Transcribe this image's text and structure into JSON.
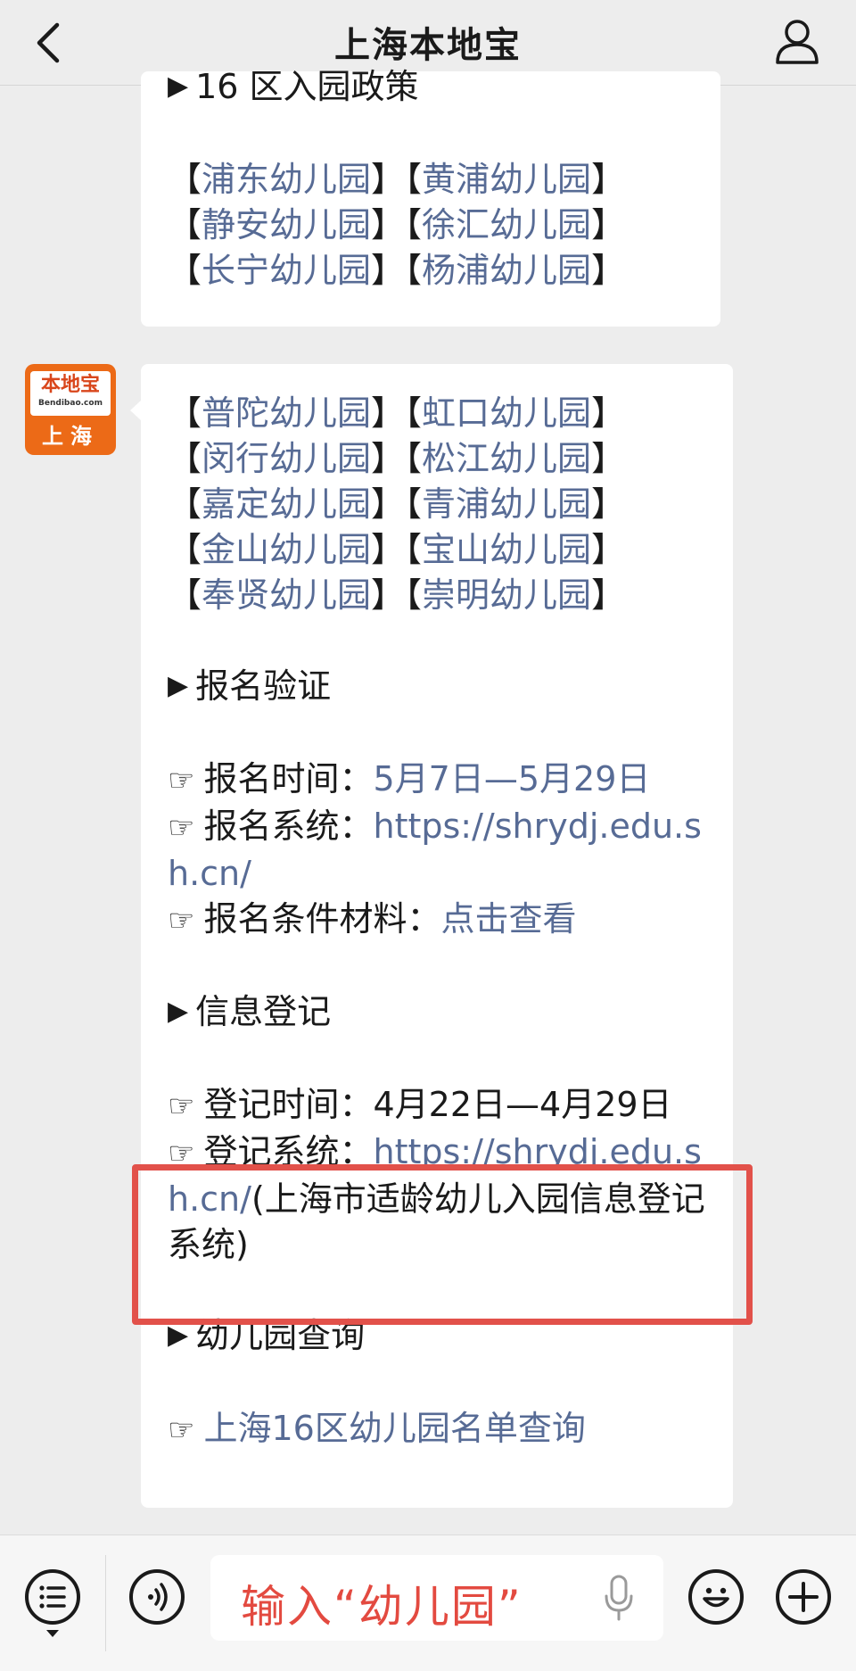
{
  "header": {
    "title": "上海本地宝"
  },
  "account": {
    "logo_name": "本地宝",
    "logo_url": "Bendibao.com",
    "logo_city": "上海"
  },
  "bubble1": {
    "heading": "16 区入园政策",
    "rows": [
      [
        "浦东幼儿园",
        "黄浦幼儿园"
      ],
      [
        "静安幼儿园",
        "徐汇幼儿园"
      ],
      [
        "长宁幼儿园",
        "杨浦幼儿园"
      ]
    ]
  },
  "bubble2": {
    "rows": [
      [
        "普陀幼儿园",
        "虹口幼儿园"
      ],
      [
        "闵行幼儿园",
        "松江幼儿园"
      ],
      [
        "嘉定幼儿园",
        "青浦幼儿园"
      ],
      [
        "金山幼儿园",
        "宝山幼儿园"
      ],
      [
        "奉贤幼儿园",
        "崇明幼儿园"
      ]
    ],
    "section_signup": {
      "heading": "报名验证",
      "time_label": "报名时间：",
      "time_value": "5月7日—5月29日",
      "system_label": "报名系统：",
      "system_url": "https://shrydj.edu.sh.cn/",
      "materials_label": "报名条件材料：",
      "materials_link": "点击查看"
    },
    "section_register": {
      "heading": "信息登记",
      "time_label": "登记时间：",
      "time_value": "4月22日—4月29日",
      "system_label": "登记系统：",
      "system_url": "https://shrydj.edu.sh.cn/",
      "system_note": "(上海市适龄幼儿入园信息登记系统)"
    },
    "section_query": {
      "heading": "幼儿园查询",
      "link": "上海16区幼儿园名单查询"
    }
  },
  "input": {
    "text": "输入“幼儿园”"
  },
  "icons": {
    "back": "chevron-left-icon",
    "profile": "person-icon",
    "menu": "menu-list-icon",
    "voice": "voice-icon",
    "mic": "microphone-icon",
    "emoji": "emoji-icon",
    "plus": "plus-icon"
  },
  "colors": {
    "link": "#576b95",
    "highlight": "#e2514a",
    "input_text": "#e34a40",
    "avatar_bg": "#ec6a17"
  }
}
